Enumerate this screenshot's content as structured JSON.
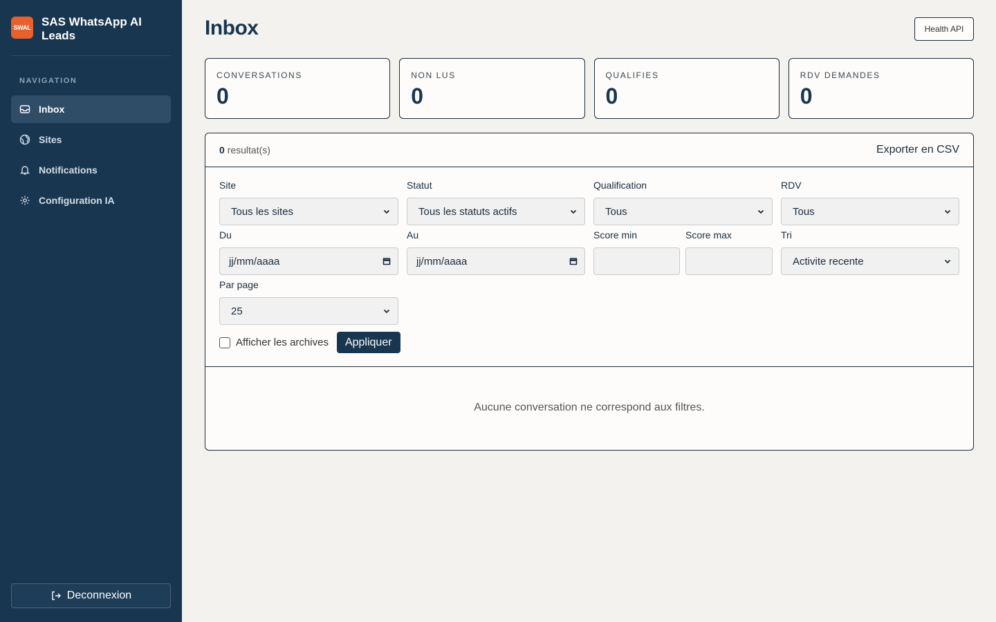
{
  "app": {
    "logo_text": "SWAL",
    "name": "SAS WhatsApp AI Leads"
  },
  "sidebar": {
    "section_title": "NAVIGATION",
    "items": [
      {
        "label": "Inbox",
        "icon": "inbox-icon",
        "active": true
      },
      {
        "label": "Sites",
        "icon": "globe-icon",
        "active": false
      },
      {
        "label": "Notifications",
        "icon": "bell-icon",
        "active": false
      },
      {
        "label": "Configuration IA",
        "icon": "gear-icon",
        "active": false
      }
    ],
    "logout_label": "Deconnexion"
  },
  "header": {
    "title": "Inbox",
    "health_button": "Health API"
  },
  "stats": [
    {
      "label": "CONVERSATIONS",
      "value": "0"
    },
    {
      "label": "NON LUS",
      "value": "0"
    },
    {
      "label": "QUALIFIES",
      "value": "0"
    },
    {
      "label": "RDV DEMANDES",
      "value": "0"
    }
  ],
  "results": {
    "count": "0",
    "suffix": "resultat(s)",
    "export_label": "Exporter en CSV"
  },
  "filters": {
    "site": {
      "label": "Site",
      "value": "Tous les sites"
    },
    "statut": {
      "label": "Statut",
      "value": "Tous les statuts actifs"
    },
    "qualification": {
      "label": "Qualification",
      "value": "Tous"
    },
    "rdv": {
      "label": "RDV",
      "value": "Tous"
    },
    "du": {
      "label": "Du",
      "placeholder": "jj/mm/aaaa"
    },
    "au": {
      "label": "Au",
      "placeholder": "jj/mm/aaaa"
    },
    "score_min": {
      "label": "Score min",
      "value": ""
    },
    "score_max": {
      "label": "Score max",
      "value": ""
    },
    "tri": {
      "label": "Tri",
      "value": "Activite recente"
    },
    "par_page": {
      "label": "Par page",
      "value": "25"
    },
    "archives_label": "Afficher les archives",
    "apply_label": "Appliquer"
  },
  "empty_message": "Aucune conversation ne correspond aux filtres.",
  "colors": {
    "sidebar_bg": "#183650",
    "accent_logo": "#e8602c",
    "page_bg": "#f4f2ee"
  }
}
